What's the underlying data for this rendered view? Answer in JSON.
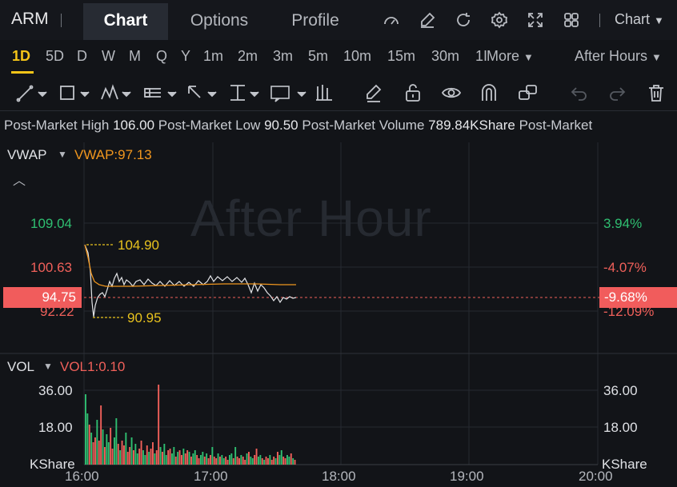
{
  "header": {
    "ticker": "ARM",
    "tabs": [
      {
        "label": "Chart",
        "active": true
      },
      {
        "label": "Options",
        "active": false
      },
      {
        "label": "Profile",
        "active": false
      }
    ],
    "icons": [
      "gauge-icon",
      "edit-icon",
      "refresh-icon",
      "settings-icon",
      "fullscreen-icon",
      "grid-icon"
    ],
    "chart_type_label": "Chart"
  },
  "periods": {
    "items": [
      "1D",
      "5D",
      "D",
      "W",
      "M",
      "Q",
      "Y",
      "1m",
      "2m",
      "3m",
      "5m",
      "10m",
      "15m",
      "30m"
    ],
    "active": "1D",
    "truncated": "1I",
    "more_label": "More",
    "session_label": "After Hours"
  },
  "toolbar": {
    "icons": [
      "line-tool-icon",
      "rectangle-tool-icon",
      "pattern-tool-icon",
      "fibonacci-tool-icon",
      "arrow-tool-icon",
      "measure-tool-icon",
      "text-tool-icon",
      "candle-tool-icon",
      "pencil-icon",
      "unlock-icon",
      "eye-icon",
      "magnet-icon",
      "link-icon",
      "undo-icon",
      "redo-icon",
      "trash-icon"
    ]
  },
  "info": {
    "high_label": "Post-Market High",
    "high_value": "106.00",
    "low_label": "Post-Market Low",
    "low_value": "90.50",
    "volume_label": "Post-Market Volume",
    "volume_value": "789.84KShare",
    "trail_label": "Post-Market"
  },
  "main_pane": {
    "indicator": "VWAP",
    "indicator_value": "VWAP:97.13",
    "watermark": "After Hour",
    "left_axis": [
      "109.04",
      "100.63",
      "92.22"
    ],
    "right_axis": [
      "3.94%",
      "-4.07%",
      "-12.09%"
    ],
    "current_price": "94.75",
    "current_pct": "-9.68%",
    "high_marker": "104.90",
    "low_marker": "90.95"
  },
  "volume_pane": {
    "indicator": "VOL",
    "indicator_value": "VOL1:0.10",
    "left_axis": [
      "36.00",
      "18.00",
      "KShare"
    ],
    "right_axis": [
      "36.00",
      "18.00",
      "KShare"
    ]
  },
  "time_axis": [
    "16:00",
    "17:00",
    "18:00",
    "19:00",
    "20:00"
  ],
  "colors": {
    "up": "#2fbf71",
    "down": "#f0605a",
    "accent": "#f5c518",
    "vwap": "#f0961e"
  }
}
